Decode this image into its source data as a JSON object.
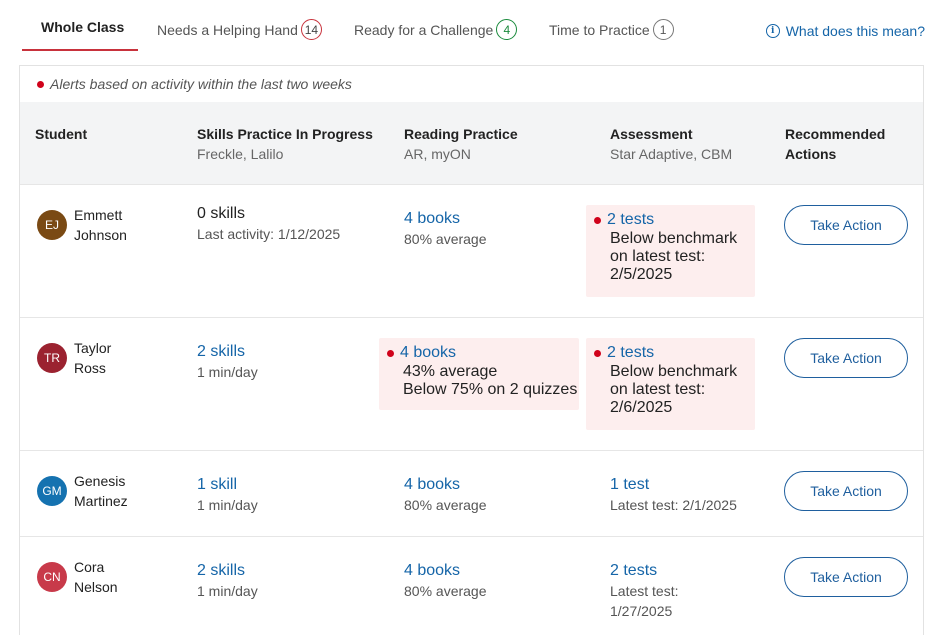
{
  "tabs": [
    {
      "label": "Whole Class",
      "count": ""
    },
    {
      "label": "Needs a Helping Hand",
      "count": "14"
    },
    {
      "label": "Ready for a Challenge",
      "count": "4"
    },
    {
      "label": "Time to Practice",
      "count": "1"
    }
  ],
  "help_link": "What does this mean?",
  "alert_note": "Alerts based on activity within the last two weeks",
  "columns": {
    "student": {
      "title": "Student"
    },
    "skills": {
      "title": "Skills Practice In Progress",
      "sub": "Freckle, Lalilo"
    },
    "reading": {
      "title": "Reading Practice",
      "sub": "AR, myON"
    },
    "assessment": {
      "title": "Assessment",
      "sub": "Star Adaptive, CBM"
    },
    "actions": {
      "title_1": "Recommended",
      "title_2": "Actions"
    }
  },
  "action_label": "Take Action",
  "colors": {
    "alert_dot": "#d0021b",
    "alert_bg": "#fdeeee",
    "link": "#1565a8",
    "tab_underline": "#c8323c"
  },
  "students": [
    {
      "initials": "EJ",
      "first": "Emmett",
      "last": "Johnson",
      "avatar_color": "#7a4a14",
      "skills_value": "0 skills",
      "skills_sub": "Last activity: 1/12/2025",
      "reading_value": "4 books",
      "reading_sub_1": "80% average",
      "reading_sub_2": "",
      "assessment_value": "2 tests",
      "assessment_sub_1": "Below benchmark",
      "assessment_sub_2": "on latest test:",
      "assessment_sub_3": "2/5/2025"
    },
    {
      "initials": "TR",
      "first": "Taylor",
      "last": "Ross",
      "avatar_color": "#9b2230",
      "skills_value": "2 skills",
      "skills_sub": "1 min/day",
      "reading_value": "4 books",
      "reading_sub_1": "43% average",
      "reading_sub_2": "Below 75% on 2 quizzes",
      "assessment_value": "2 tests",
      "assessment_sub_1": "Below benchmark",
      "assessment_sub_2": "on latest test:",
      "assessment_sub_3": "2/6/2025"
    },
    {
      "initials": "GM",
      "first": "Genesis",
      "last": "Martinez",
      "avatar_color": "#1572b0",
      "skills_value": "1 skill",
      "skills_sub": "1 min/day",
      "reading_value": "4 books",
      "reading_sub_1": "80% average",
      "reading_sub_2": "",
      "assessment_value": "1 test",
      "assessment_sub_1": "Latest test: 2/1/2025",
      "assessment_sub_2": "",
      "assessment_sub_3": ""
    },
    {
      "initials": "CN",
      "first": "Cora",
      "last": "Nelson",
      "avatar_color": "#c83a4a",
      "skills_value": "2 skills",
      "skills_sub": "1 min/day",
      "reading_value": "4 books",
      "reading_sub_1": "80% average",
      "reading_sub_2": "",
      "assessment_value": "2 tests",
      "assessment_sub_1": "Latest test:",
      "assessment_sub_2": "1/27/2025",
      "assessment_sub_3": ""
    }
  ]
}
